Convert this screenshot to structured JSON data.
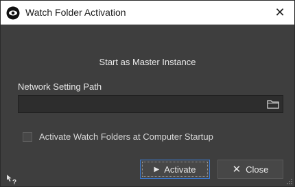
{
  "window": {
    "title": "Watch Folder Activation",
    "close_glyph": "✕"
  },
  "dialog": {
    "subtitle": "Start as Master Instance",
    "path_label": "Network Setting Path",
    "path_value": "",
    "startup_checkbox_label": "Activate Watch Folders at Computer Startup",
    "startup_checked": false
  },
  "buttons": {
    "activate_label": "Activate",
    "close_label": "Close"
  },
  "icons": {
    "app": "eye-logo-icon",
    "browse": "folder-icon",
    "help": "whats-this-help-icon",
    "activate": "play-icon",
    "close": "x-icon",
    "resize": "resize-grip-icon"
  },
  "colors": {
    "background": "#3e3e3e",
    "titlebar": "#ffffff",
    "field": "#2d2d2d",
    "focus": "#3a7bd5"
  }
}
